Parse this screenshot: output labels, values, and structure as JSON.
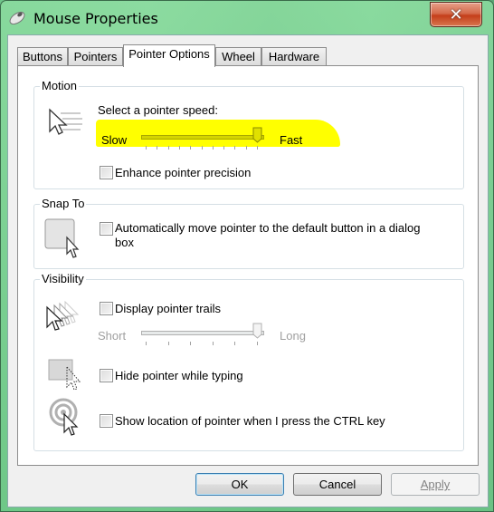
{
  "window": {
    "title": "Mouse Properties",
    "icon": "mouse-icon",
    "close_icon": "close-icon"
  },
  "tabs": [
    {
      "label": "Buttons",
      "active": false
    },
    {
      "label": "Pointers",
      "active": false
    },
    {
      "label": "Pointer Options",
      "active": true
    },
    {
      "label": "Wheel",
      "active": false
    },
    {
      "label": "Hardware",
      "active": false
    }
  ],
  "motion": {
    "group_label": "Motion",
    "icon": "pointer-speed-icon",
    "speed_prompt": "Select a pointer speed:",
    "slow_label": "Slow",
    "fast_label": "Fast",
    "speed_value": 10,
    "speed_max": 10,
    "highlight_color": "#ffff00",
    "enhance_precision": {
      "label": "Enhance pointer precision",
      "checked": false
    }
  },
  "snap_to": {
    "group_label": "Snap To",
    "icon": "snap-to-button-icon",
    "auto_move": {
      "label_line1": "Automatically move pointer to the default button in a dialog",
      "label_line2": "box",
      "checked": false
    }
  },
  "visibility": {
    "group_label": "Visibility",
    "trails": {
      "label": "Display pointer trails",
      "checked": false,
      "icon": "pointer-trails-icon"
    },
    "short_label": "Short",
    "long_label": "Long",
    "trail_value": 5,
    "trail_max": 5,
    "hide_typing": {
      "label": "Hide pointer while typing",
      "checked": false,
      "icon": "hide-pointer-icon"
    },
    "show_location": {
      "label": "Show location of pointer when I press the CTRL key",
      "checked": false,
      "icon": "pointer-location-icon"
    }
  },
  "buttons": {
    "ok": "OK",
    "cancel": "Cancel",
    "apply": "Apply"
  }
}
